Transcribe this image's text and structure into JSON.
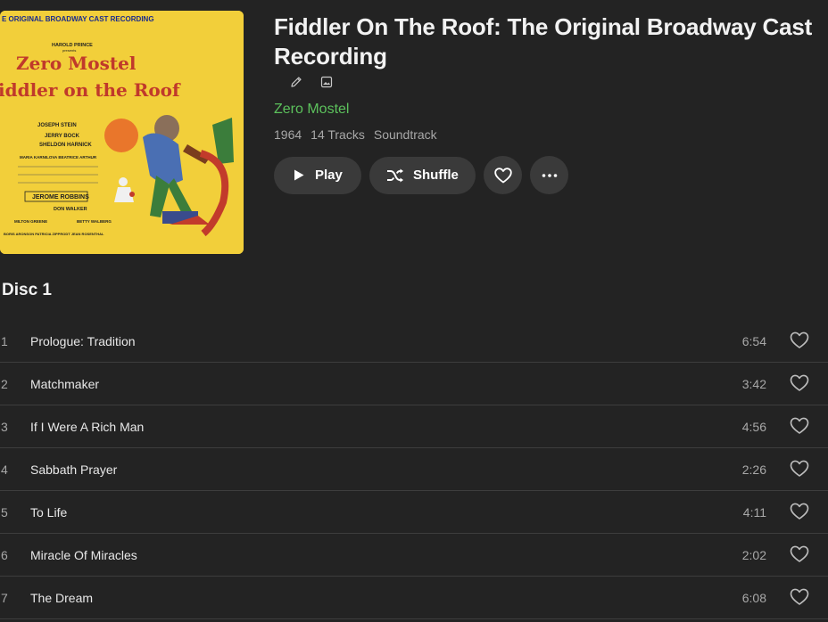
{
  "album": {
    "title": "Fiddler On The Roof: The Original Broadway Cast Recording",
    "artist": "Zero Mostel",
    "year": "1964",
    "track_count": "14 Tracks",
    "genre": "Soundtrack",
    "artist_color": "#5cc15c"
  },
  "cover": {
    "top_line": "E ORIGINAL BROADWAY CAST RECORDING",
    "producer": "HAROLD PRINCE",
    "presents": "presents",
    "star": "Zero Mostel",
    "show": "iddler on the Roof",
    "credit_1": "JOSEPH STEIN",
    "credit_2": "JERRY BOCK",
    "credit_3": "SHELDON HARNICK",
    "credit_4": "MARIA KARNILOVA   BEATRICE ARTHUR",
    "credit_5": "JEROME ROBBINS",
    "credit_6": "DON WALKER",
    "credit_7": "MILTON GREENE",
    "credit_8": "BETTY WALBERG",
    "credit_9": "BORIS ARONSON   PATRICIA ZIPPRODT   JEAN ROSENTHAL"
  },
  "icons": {
    "edit": "pencil-icon",
    "artwork": "image-icon",
    "play": "play-icon",
    "shuffle": "shuffle-icon",
    "favorite": "heart-icon",
    "more": "ellipsis-icon"
  },
  "actions": {
    "play_label": "Play",
    "shuffle_label": "Shuffle"
  },
  "disc": {
    "title": "Disc 1",
    "tracks": [
      {
        "number": "1",
        "title": "Prologue: Tradition",
        "duration": "6:54"
      },
      {
        "number": "2",
        "title": "Matchmaker",
        "duration": "3:42"
      },
      {
        "number": "3",
        "title": "If I Were A Rich Man",
        "duration": "4:56"
      },
      {
        "number": "4",
        "title": "Sabbath Prayer",
        "duration": "2:26"
      },
      {
        "number": "5",
        "title": "To Life",
        "duration": "4:11"
      },
      {
        "number": "6",
        "title": "Miracle Of Miracles",
        "duration": "2:02"
      },
      {
        "number": "7",
        "title": "The Dream",
        "duration": "6:08"
      }
    ]
  }
}
